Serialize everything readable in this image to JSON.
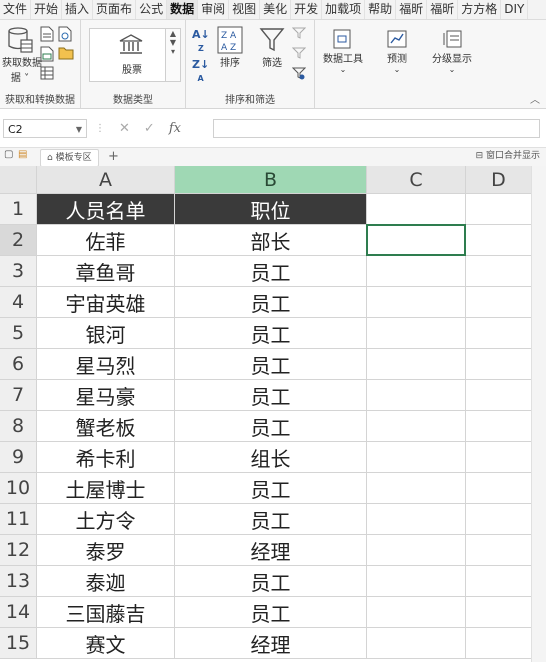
{
  "menu_tabs": [
    "文件",
    "开始",
    "插入",
    "页面布",
    "公式",
    "数据",
    "审阅",
    "视图",
    "美化",
    "开发",
    "加载项",
    "帮助",
    "福昕",
    "福昕",
    "方方格",
    "DIY"
  ],
  "active_tab": "数据",
  "ribbon": {
    "get_data": {
      "label": "获取数据",
      "label2": "据 ˅",
      "group": "获取和转换数据"
    },
    "data_type": {
      "stock": "股票",
      "group": "数据类型"
    },
    "sort_filter": {
      "sort": "排序",
      "filter": "筛选",
      "group": "排序和筛选"
    },
    "data_tools": {
      "label": "数据工具"
    },
    "forecast": {
      "label": "预测"
    },
    "outline": {
      "label": "分级显示"
    }
  },
  "formula_bar": {
    "name_box": "C2",
    "formula": ""
  },
  "sheet_tabs": {
    "template": "模板专区",
    "add": "+",
    "merge_display": "窗口合并显示"
  },
  "columns": [
    "A",
    "B",
    "C",
    "D"
  ],
  "selected_column": "B",
  "selected_cell": "C2",
  "table": {
    "headers": [
      "人员名单",
      "职位"
    ],
    "rows": [
      [
        "佐菲",
        "部长"
      ],
      [
        "章鱼哥",
        "员工"
      ],
      [
        "宇宙英雄",
        "员工"
      ],
      [
        "银河",
        "员工"
      ],
      [
        "星马烈",
        "员工"
      ],
      [
        "星马豪",
        "员工"
      ],
      [
        "蟹老板",
        "员工"
      ],
      [
        "希卡利",
        "组长"
      ],
      [
        "土屋博士",
        "员工"
      ],
      [
        "土方令",
        "员工"
      ],
      [
        "泰罗",
        "经理"
      ],
      [
        "泰迦",
        "员工"
      ],
      [
        "三国藤吉",
        "员工"
      ],
      [
        "赛文",
        "经理"
      ]
    ]
  },
  "row_numbers": [
    "1",
    "2",
    "3",
    "4",
    "5",
    "6",
    "7",
    "8",
    "9",
    "10",
    "11",
    "12",
    "13",
    "14",
    "15"
  ],
  "colors": {
    "selected_col_header": "#9fd8b4",
    "header_fill": "#3a3a3a",
    "selection_border": "#2e7d4f"
  }
}
